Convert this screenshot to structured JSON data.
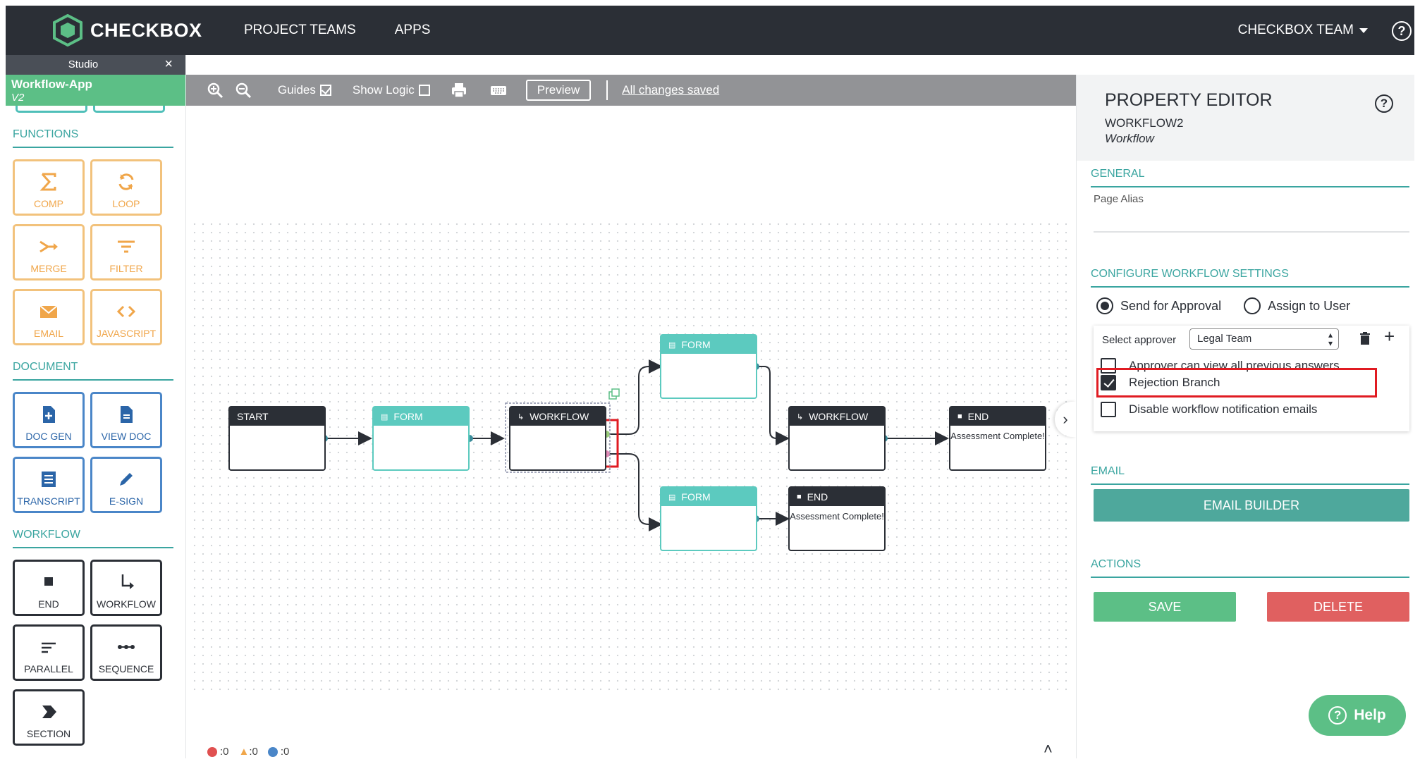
{
  "topbar": {
    "brand": "CHECKBOX",
    "nav": [
      "PROJECT TEAMS",
      "APPS"
    ],
    "team": "CHECKBOX TEAM",
    "help": "?"
  },
  "sidebar": {
    "studio_label": "Studio",
    "close": "×",
    "app_name": "Workflow-App",
    "app_version": "V2",
    "functions_heading": "FUNCTIONS",
    "functions": [
      "COMP",
      "LOOP",
      "MERGE",
      "FILTER",
      "EMAIL",
      "JAVASCRIPT"
    ],
    "document_heading": "DOCUMENT",
    "document": [
      "DOC GEN",
      "VIEW DOC",
      "TRANSCRIPT",
      "E-SIGN"
    ],
    "workflow_heading": "WORKFLOW",
    "workflow": [
      "END",
      "WORKFLOW",
      "PARALLEL",
      "SEQUENCE",
      "SECTION"
    ]
  },
  "toolbar": {
    "guides_label": "Guides",
    "guides_checked": true,
    "show_logic_label": "Show Logic",
    "show_logic_checked": false,
    "preview_label": "Preview",
    "status": "All changes saved"
  },
  "canvas": {
    "nodes": {
      "start": "START",
      "form1": "FORM",
      "workflow1": "WORKFLOW",
      "form_top": "FORM",
      "form_bottom": "FORM",
      "workflow2": "WORKFLOW",
      "end1": "END",
      "end1_body": "Assessment Complete!",
      "end2": "END",
      "end2_body": "Assessment Complete!"
    },
    "status_counts": {
      "errors": ":0",
      "warnings": ":0",
      "info": ":0"
    },
    "colors": {
      "node_dark": "#2b2f36",
      "form_teal": "#5ccabf",
      "highlight_red": "#e01b22"
    }
  },
  "property_editor": {
    "title": "PROPERTY EDITOR",
    "subtitle": "WORKFLOW2",
    "type": "Workflow",
    "general_heading": "GENERAL",
    "page_alias_label": "Page Alias",
    "configure_heading": "CONFIGURE WORKFLOW SETTINGS",
    "radio_send": "Send for Approval",
    "radio_assign": "Assign to User",
    "radio_selected": "Send for Approval",
    "select_approver_label": "Select approver",
    "approver_value": "Legal Team",
    "option_view_answers": "Approver can view all previous answers",
    "option_view_answers_checked": false,
    "option_rejection": "Rejection Branch",
    "option_rejection_checked": true,
    "option_disable_notifications": "Disable workflow notification emails",
    "option_disable_notifications_checked": false,
    "email_heading": "EMAIL",
    "email_builder_label": "EMAIL BUILDER",
    "actions_heading": "ACTIONS",
    "save_label": "SAVE",
    "delete_label": "DELETE",
    "colors": {
      "accent": "#3aa5a0",
      "save": "#5cbf86",
      "delete": "#e06060",
      "email_builder": "#4ea89c"
    }
  },
  "help_button": "Help"
}
